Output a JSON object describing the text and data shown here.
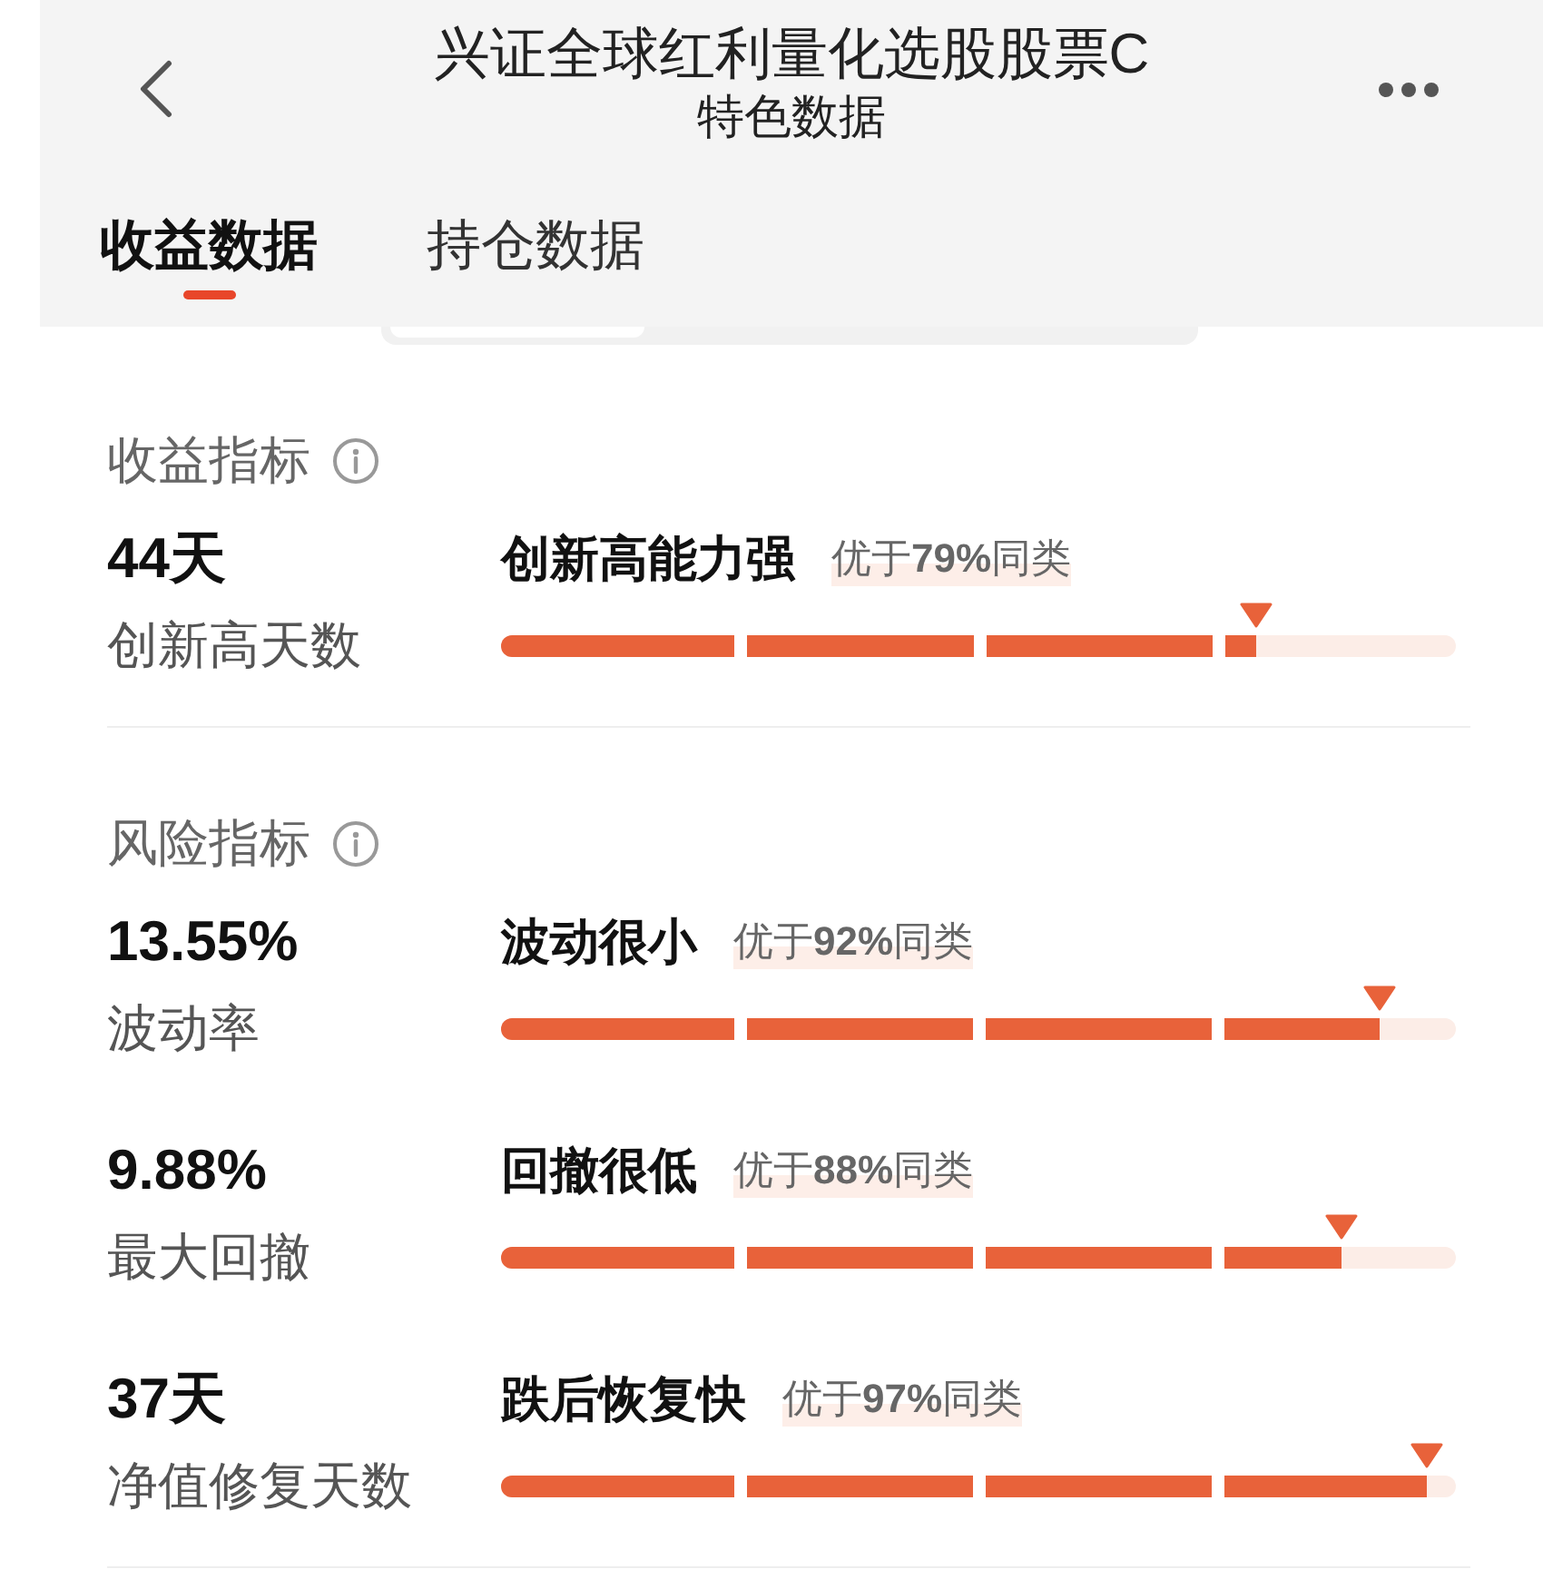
{
  "header": {
    "title": "兴证全球红利量化选股股票C",
    "subtitle": "特色数据"
  },
  "tabs": [
    {
      "label": "收益数据",
      "selected": true
    },
    {
      "label": "持仓数据",
      "selected": false
    }
  ],
  "sections": [
    {
      "title": "收益指标",
      "metrics": [
        {
          "value": "44天",
          "label": "创新高天数",
          "rating": "创新高能力强",
          "comparison": "优于**79%**同类",
          "level": 0.79
        }
      ]
    },
    {
      "title": "风险指标",
      "metrics": [
        {
          "value": "13.55%",
          "label": "波动率",
          "rating": "波动很小",
          "comparison": "优于**92%**同类",
          "level": 0.92
        },
        {
          "value": "9.88%",
          "label": "最大回撤",
          "rating": "回撤很低",
          "comparison": "优于**88%**同类",
          "level": 0.88
        },
        {
          "value": "37天",
          "label": "净值修复天数",
          "rating": "跌后恢复快",
          "comparison": "优于**97%**同类",
          "level": 0.97
        }
      ]
    }
  ]
}
